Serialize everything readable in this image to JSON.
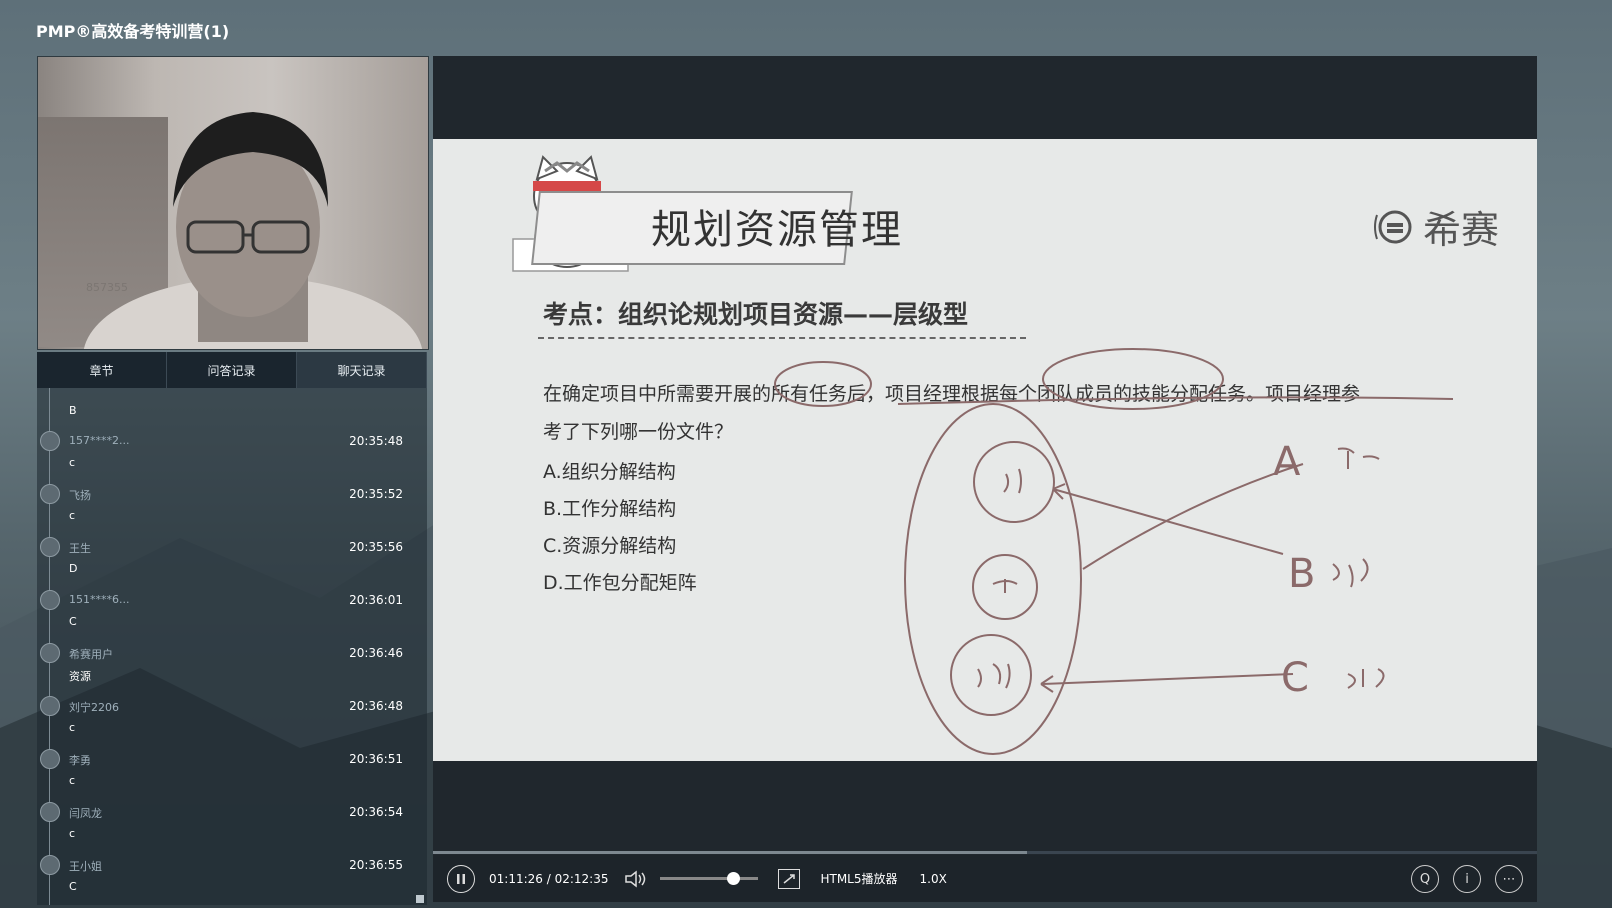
{
  "app": {
    "title": "PMP®高效备考特训营(1)"
  },
  "webcam": {
    "overlay_text": "857355"
  },
  "sidebar": {
    "tabs": [
      {
        "label": "章节"
      },
      {
        "label": "问答记录"
      },
      {
        "label": "聊天记录"
      }
    ],
    "first_message": {
      "text": "B"
    },
    "messages": [
      {
        "user": "157****2...",
        "time": "20:35:48",
        "text": "c"
      },
      {
        "user": "飞扬",
        "time": "20:35:52",
        "text": "c"
      },
      {
        "user": "王生",
        "time": "20:35:56",
        "text": "D"
      },
      {
        "user": "151****6...",
        "time": "20:36:01",
        "text": "C"
      },
      {
        "user": "希赛用户",
        "time": "20:36:46",
        "text": "资源"
      },
      {
        "user": "刘宁2206",
        "time": "20:36:48",
        "text": "c"
      },
      {
        "user": "李勇",
        "time": "20:36:51",
        "text": "c"
      },
      {
        "user": "闫凤龙",
        "time": "20:36:54",
        "text": "c"
      },
      {
        "user": "王小姐",
        "time": "20:36:55",
        "text": "C"
      }
    ]
  },
  "slide": {
    "title": "规划资源管理",
    "logo_text": "希赛",
    "topic": "考点：组织论规划项目资源——层级型",
    "question": "在确定项目中所需要开展的所有任务后，项目经理根据每个团队成员的技能分配任务。项目经理参考了下列哪一份文件？",
    "options": [
      "A.组织分解结构",
      "B.工作分解结构",
      "C.资源分解结构",
      "D.工作包分配矩阵"
    ],
    "annotations": {
      "a": "A",
      "b": "B",
      "c": "C"
    }
  },
  "player": {
    "time": "01:11:26 / 02:12:35",
    "engine_label": "HTML5播放器",
    "speed": "1.0X",
    "progress_percent": 53.8,
    "volume_percent": 74
  },
  "colors": {
    "accent": "#1d242a",
    "slide_bg": "#e7e9e8",
    "annotation": "#8b6a6a"
  }
}
